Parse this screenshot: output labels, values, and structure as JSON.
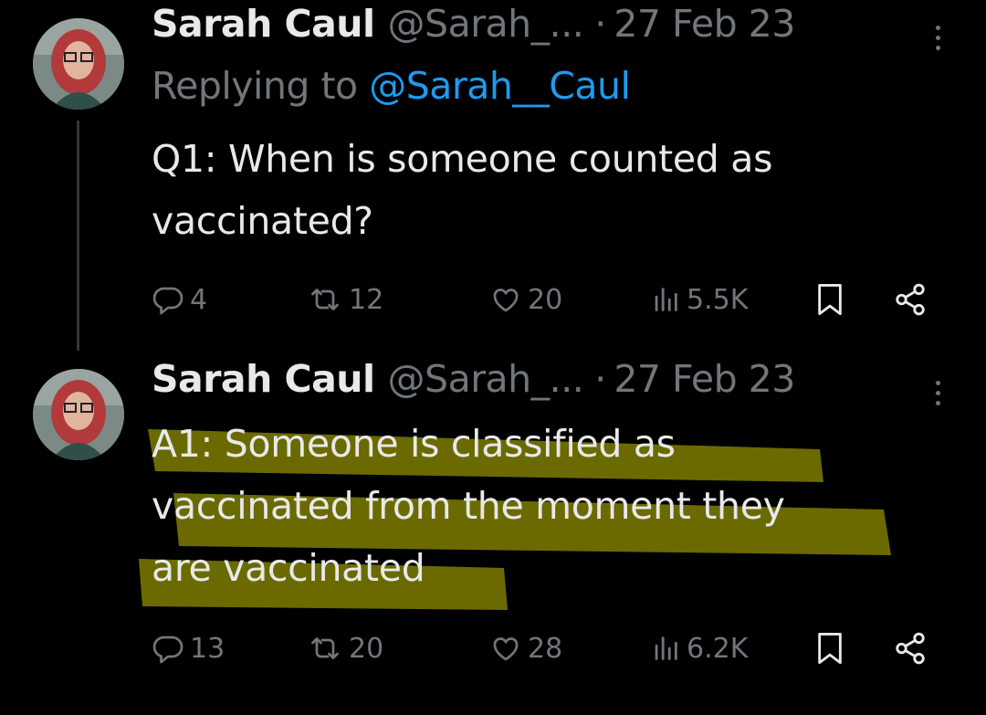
{
  "tweets": [
    {
      "author_name": "Sarah Caul",
      "handle": "@Sarah_...",
      "separator": "·",
      "date": "27 Feb 23",
      "replying_prefix": "Replying to ",
      "replying_handle": "@Sarah__Caul",
      "text_lines": [
        "Q1: When is someone counted as",
        "vaccinated?"
      ],
      "actions": {
        "replies": "4",
        "retweets": "12",
        "likes": "20",
        "views": "5.5K"
      }
    },
    {
      "author_name": "Sarah Caul",
      "handle": "@Sarah_...",
      "separator": "·",
      "date": "27 Feb 23",
      "text_lines": [
        "A1: Someone is classified as",
        "vaccinated from the moment they",
        "are vaccinated"
      ],
      "highlight_color": "#6b6a00",
      "actions": {
        "replies": "13",
        "retweets": "20",
        "likes": "28",
        "views": "6.2K"
      }
    }
  ],
  "colors": {
    "background": "#000000",
    "text": "#e7e9ea",
    "muted": "#71767b",
    "link": "#1d9bf0"
  },
  "icons": [
    "reply-icon",
    "retweet-icon",
    "like-icon",
    "views-icon",
    "bookmark-icon",
    "share-icon",
    "more-icon"
  ]
}
